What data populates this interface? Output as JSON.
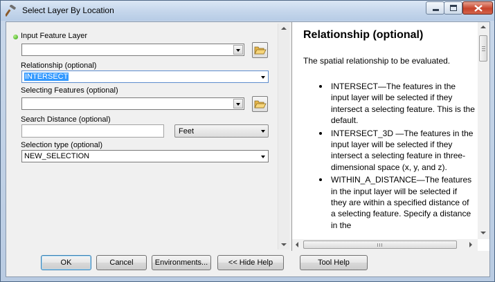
{
  "window": {
    "title": "Select Layer By Location"
  },
  "form": {
    "input_feature_layer": {
      "label": "Input Feature Layer",
      "value": ""
    },
    "relationship": {
      "label": "Relationship (optional)",
      "value": "INTERSECT"
    },
    "selecting_features": {
      "label": "Selecting Features (optional)",
      "value": ""
    },
    "search_distance": {
      "label": "Search Distance (optional)",
      "value": "",
      "units": "Feet"
    },
    "selection_type": {
      "label": "Selection type (optional)",
      "value": "NEW_SELECTION"
    }
  },
  "help": {
    "title": "Relationship (optional)",
    "intro": "The spatial relationship to be evaluated.",
    "items": [
      "INTERSECT—The features in the input layer will be selected if they intersect a selecting feature. This is the default.",
      "INTERSECT_3D —The features in the input layer will be selected if they intersect a selecting feature in three-dimensional space (x, y, and z).",
      "WITHIN_A_DISTANCE—The features in the input layer will be selected if they are within a specified distance of a selecting feature. Specify a distance in the"
    ]
  },
  "buttons": {
    "ok": "OK",
    "cancel": "Cancel",
    "environments": "Environments...",
    "hide_help": "<< Hide Help",
    "tool_help": "Tool Help"
  },
  "icons": {
    "title": "hammer-icon",
    "required": "green-dot-icon",
    "browse": "folder-open-icon"
  },
  "colors": {
    "selection_highlight": "#3399ff",
    "required_dot": "#2ea10c",
    "close_button": "#c7432b"
  }
}
